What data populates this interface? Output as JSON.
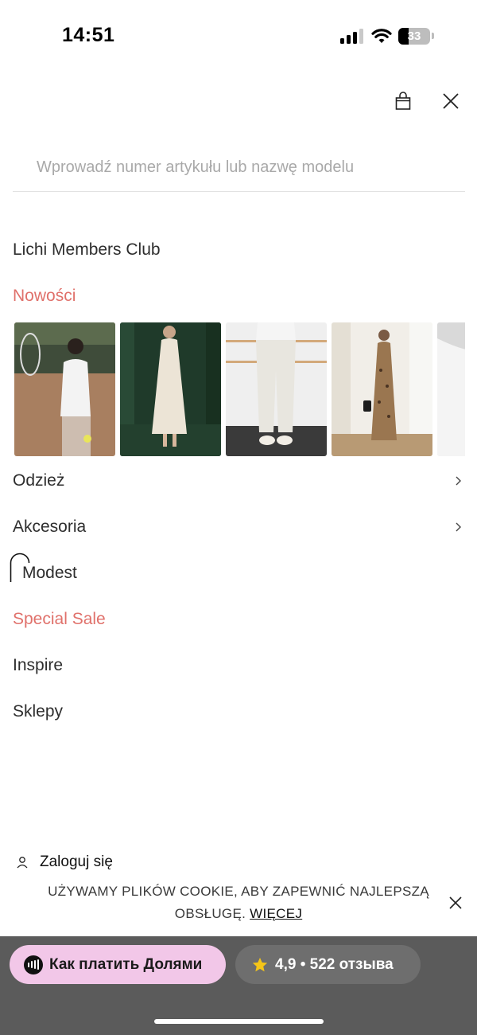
{
  "status_bar": {
    "time": "14:51",
    "battery_percent": "33",
    "battery_level": 0.33,
    "icons": [
      "cellular-signal-icon",
      "wifi-icon",
      "battery-icon"
    ]
  },
  "header": {
    "icons": [
      "shopping-bag-icon",
      "close-icon"
    ]
  },
  "search": {
    "placeholder": "Wprowadź numer artykułu lub nazwę modelu",
    "value": ""
  },
  "menu": {
    "members_club": "Lichi Members Club",
    "new_label": "Nowości",
    "clothing": "Odzież",
    "accessories": "Akcesoria",
    "modest": "Modest",
    "special_sale": "Special Sale",
    "inspire": "Inspire",
    "stores": "Sklepy"
  },
  "carousel": {
    "tiles": [
      {
        "subject": "woman with tennis racket in white top"
      },
      {
        "subject": "woman in cream dress against green curtain"
      },
      {
        "subject": "cream wide trousers and loafers"
      },
      {
        "subject": "woman in leopard print slip dress"
      },
      {
        "subject": "woman in white top (partially visible)"
      }
    ]
  },
  "account": {
    "login_label": "Zaloguj się"
  },
  "cookie_banner": {
    "text": "UŻYWAMY PLIKÓW COOKIE, ABY ZAPEWNIĆ NAJLEPSZĄ OBSŁUGĘ.",
    "link": "WIĘCEJ"
  },
  "bottom_bar": {
    "pay_button": "Как платить Долями",
    "rating": "4,9 • 522 отзыва"
  },
  "colors": {
    "accent": "#e0716b",
    "bottom_bar": "#5b5b5b",
    "pay_pill": "#f2c7e8"
  }
}
